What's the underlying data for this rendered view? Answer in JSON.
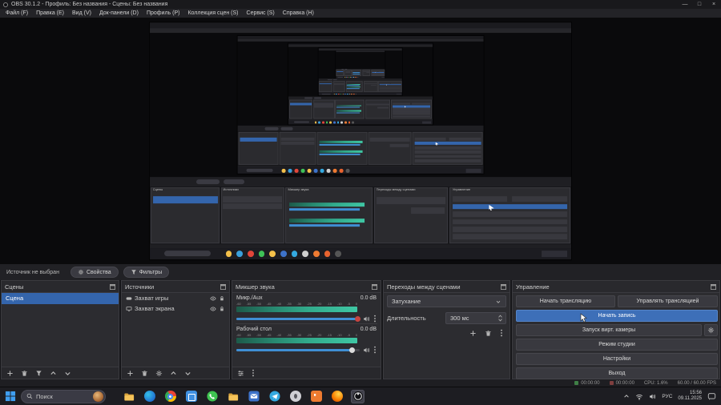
{
  "window": {
    "title": "OBS 30.1.2 - Профиль: Без названия - Сцены: Без названия",
    "minimize": "—",
    "maximize": "□",
    "close": "×"
  },
  "menu": {
    "items": [
      "Файл (F)",
      "Правка (E)",
      "Вид (V)",
      "Док-панели (D)",
      "Профиль (P)",
      "Коллекция сцен (S)",
      "Сервис (S)",
      "Справка (H)"
    ]
  },
  "source_row": {
    "message": "Источник не выбран",
    "properties": "Свойства",
    "filters": "Фильтры"
  },
  "scenes": {
    "title": "Сцены",
    "items": [
      "Сцена"
    ]
  },
  "sources": {
    "title": "Источники",
    "items": [
      {
        "name": "Захват игры"
      },
      {
        "name": "Захват экрана"
      }
    ]
  },
  "mixer": {
    "title": "Микшер звука",
    "scale": [
      "-60",
      "-55",
      "-50",
      "-45",
      "-40",
      "-35",
      "-30",
      "-25",
      "-20",
      "-15",
      "-10",
      "-5",
      "0"
    ],
    "channels": [
      {
        "name": "Микр./Aux",
        "value": "0.0 dB"
      },
      {
        "name": "Рабочий стол",
        "value": "0.0 dB"
      }
    ]
  },
  "transitions": {
    "title": "Переходы между сценами",
    "current": "Затухание",
    "duration_label": "Длительность",
    "duration_value": "300 мс"
  },
  "controls": {
    "title": "Управление",
    "start_stream": "Начать трансляцию",
    "manage_stream": "Управлять трансляцией",
    "start_record": "Начать запись",
    "virtual_cam": "Запуск вирт. камеры",
    "studio_mode": "Режим студии",
    "settings": "Настройки",
    "exit": "Выход"
  },
  "status": {
    "stream_time": "00:00:00",
    "rec_time": "00:00:00",
    "cpu": "CPU: 1.6%",
    "fps": "60.00 / 60.00 FPS"
  },
  "taskbar": {
    "search": "Поиск",
    "language": "РУС",
    "time": "15:56",
    "date": "09.11.2025"
  },
  "colors": {
    "accent_blue": "#3465ac",
    "record_button": "#3d6fb8",
    "meter_teal": "#3fc7a4"
  }
}
